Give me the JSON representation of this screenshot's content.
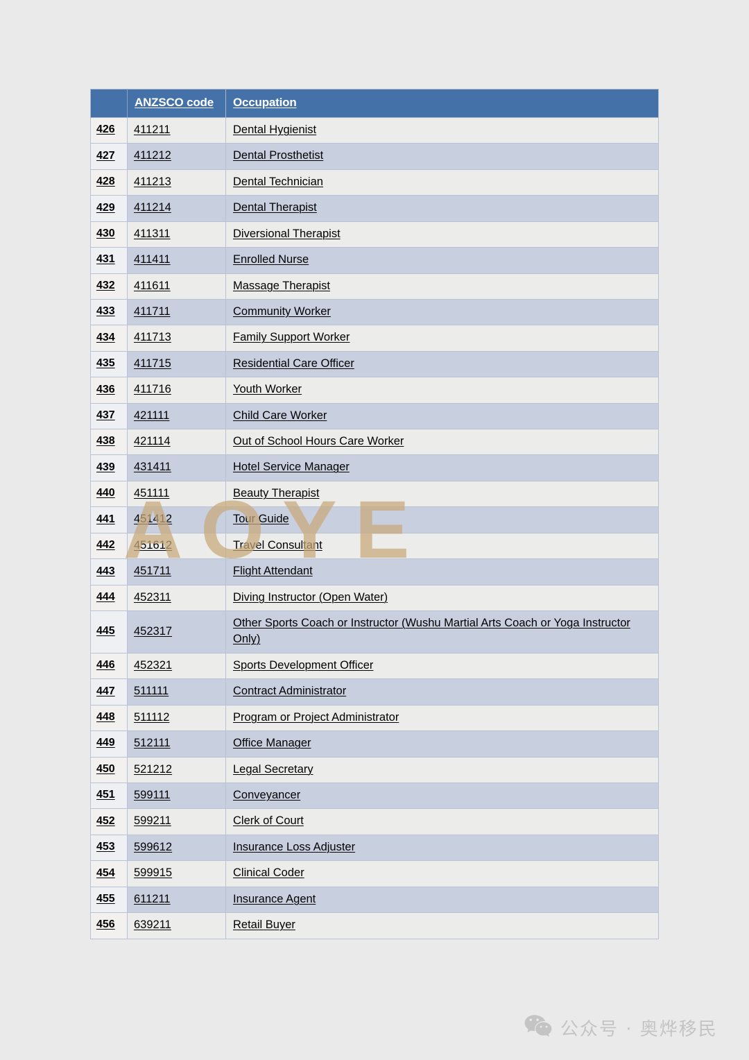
{
  "document": {
    "background_color": "#eaeaea",
    "table": {
      "header_background": "#4472a8",
      "header_text_color": "#ffffff",
      "stripe_light": "#ececea",
      "stripe_blue": "#c8d0e0",
      "columns": [
        "",
        "ANZSCO code",
        "Occupation"
      ],
      "rows": [
        {
          "index": "426",
          "code": "411211",
          "occupation": "Dental Hygienist"
        },
        {
          "index": "427",
          "code": "411212",
          "occupation": "Dental Prosthetist"
        },
        {
          "index": "428",
          "code": "411213",
          "occupation": "Dental Technician"
        },
        {
          "index": "429",
          "code": "411214",
          "occupation": "Dental Therapist"
        },
        {
          "index": "430",
          "code": "411311",
          "occupation": "Diversional Therapist"
        },
        {
          "index": "431",
          "code": "411411",
          "occupation": "Enrolled Nurse"
        },
        {
          "index": "432",
          "code": "411611",
          "occupation": "Massage Therapist"
        },
        {
          "index": "433",
          "code": "411711",
          "occupation": "Community Worker"
        },
        {
          "index": "434",
          "code": "411713",
          "occupation": "Family Support Worker"
        },
        {
          "index": "435",
          "code": "411715",
          "occupation": "Residential Care Officer"
        },
        {
          "index": "436",
          "code": "411716",
          "occupation": "Youth Worker"
        },
        {
          "index": "437",
          "code": "421111",
          "occupation": "Child Care Worker"
        },
        {
          "index": "438",
          "code": "421114",
          "occupation": "Out of School Hours Care Worker"
        },
        {
          "index": "439",
          "code": "431411",
          "occupation": "Hotel Service Manager"
        },
        {
          "index": "440",
          "code": "451111",
          "occupation": "Beauty Therapist"
        },
        {
          "index": "441",
          "code": "451412",
          "occupation": "Tour Guide"
        },
        {
          "index": "442",
          "code": "451612",
          "occupation": "Travel Consultant"
        },
        {
          "index": "443",
          "code": "451711",
          "occupation": "Flight Attendant"
        },
        {
          "index": "444",
          "code": "452311",
          "occupation": "Diving Instructor (Open Water)"
        },
        {
          "index": "445",
          "code": "452317",
          "occupation": "Other Sports Coach or Instructor (Wushu Martial Arts Coach or Yoga Instructor Only)"
        },
        {
          "index": "446",
          "code": "452321",
          "occupation": "Sports Development Officer"
        },
        {
          "index": "447",
          "code": "511111",
          "occupation": "Contract Administrator"
        },
        {
          "index": "448",
          "code": "511112",
          "occupation": "Program or Project Administrator"
        },
        {
          "index": "449",
          "code": "512111",
          "occupation": "Office Manager"
        },
        {
          "index": "450",
          "code": "521212",
          "occupation": "Legal Secretary"
        },
        {
          "index": "451",
          "code": "599111",
          "occupation": "Conveyancer"
        },
        {
          "index": "452",
          "code": "599211",
          "occupation": "Clerk of Court"
        },
        {
          "index": "453",
          "code": "599612",
          "occupation": "Insurance Loss Adjuster"
        },
        {
          "index": "454",
          "code": "599915",
          "occupation": "Clinical Coder"
        },
        {
          "index": "455",
          "code": "611211",
          "occupation": "Insurance Agent"
        },
        {
          "index": "456",
          "code": "639211",
          "occupation": "Retail Buyer"
        }
      ]
    },
    "watermark": {
      "text": "AOYE",
      "color": "#c8a87a"
    },
    "footer": {
      "icon": "wechat-icon",
      "text": "公众号 · 奥烨移民",
      "color": "#c4c4c4"
    }
  }
}
